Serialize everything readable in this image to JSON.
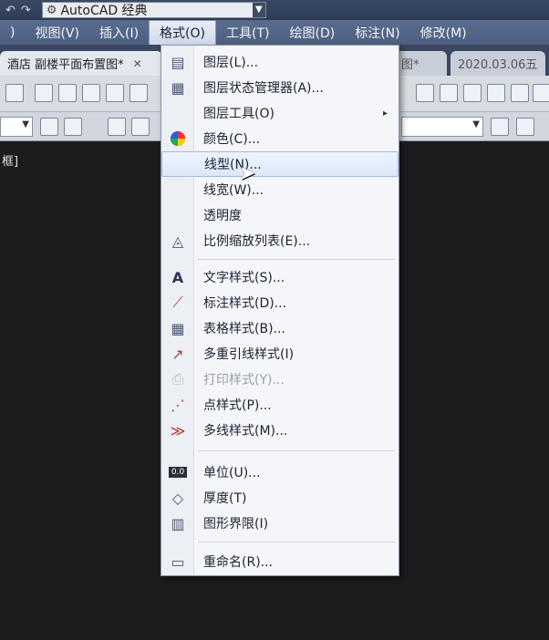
{
  "titlebar": {
    "undo": "↶",
    "redo": "↷",
    "workspace": "AutoCAD 经典"
  },
  "menubar": {
    "items": [
      ")",
      "视图(V)",
      "插入(I)",
      "格式(O)",
      "工具(T)",
      "绘图(D)",
      "标注(N)",
      "修改(M)"
    ]
  },
  "tabs": [
    {
      "label": "酒店 副楼平面布置图*",
      "close": "✕"
    },
    {
      "label": "图*"
    },
    {
      "label": "2020.03.06五"
    }
  ],
  "drawing": {
    "label": "框]"
  },
  "format_menu": {
    "items": [
      {
        "label": "图层(L)...",
        "icon": "layer-icon"
      },
      {
        "label": "图层状态管理器(A)...",
        "icon": "layer-state-icon"
      },
      {
        "label": "图层工具(O)",
        "icon": "",
        "submenu": "▸"
      },
      {
        "label": "颜色(C)...",
        "icon": "color-wheel-icon"
      },
      {
        "label": "线型(N)...",
        "icon": "",
        "hover": true
      },
      {
        "label": "线宽(W)...",
        "icon": ""
      },
      {
        "label": "透明度",
        "icon": ""
      },
      {
        "label": "比例缩放列表(E)...",
        "icon": "scale-list-icon"
      },
      {
        "label": "文字样式(S)...",
        "icon": "text-style-icon"
      },
      {
        "label": "标注样式(D)...",
        "icon": "dim-style-icon"
      },
      {
        "label": "表格样式(B)...",
        "icon": "table-style-icon"
      },
      {
        "label": "多重引线样式(I)",
        "icon": "mleader-style-icon"
      },
      {
        "label": "打印样式(Y)...",
        "icon": "plot-style-icon",
        "disabled": true
      },
      {
        "label": "点样式(P)...",
        "icon": "point-style-icon"
      },
      {
        "label": "多线样式(M)...",
        "icon": "mline-style-icon"
      },
      {
        "label": "单位(U)...",
        "icon": "units-icon"
      },
      {
        "label": "厚度(T)",
        "icon": "thickness-icon"
      },
      {
        "label": "图形界限(I)",
        "icon": "limits-icon"
      },
      {
        "label": "重命名(R)...",
        "icon": "rename-icon"
      }
    ],
    "units_glyph": "0.0"
  }
}
